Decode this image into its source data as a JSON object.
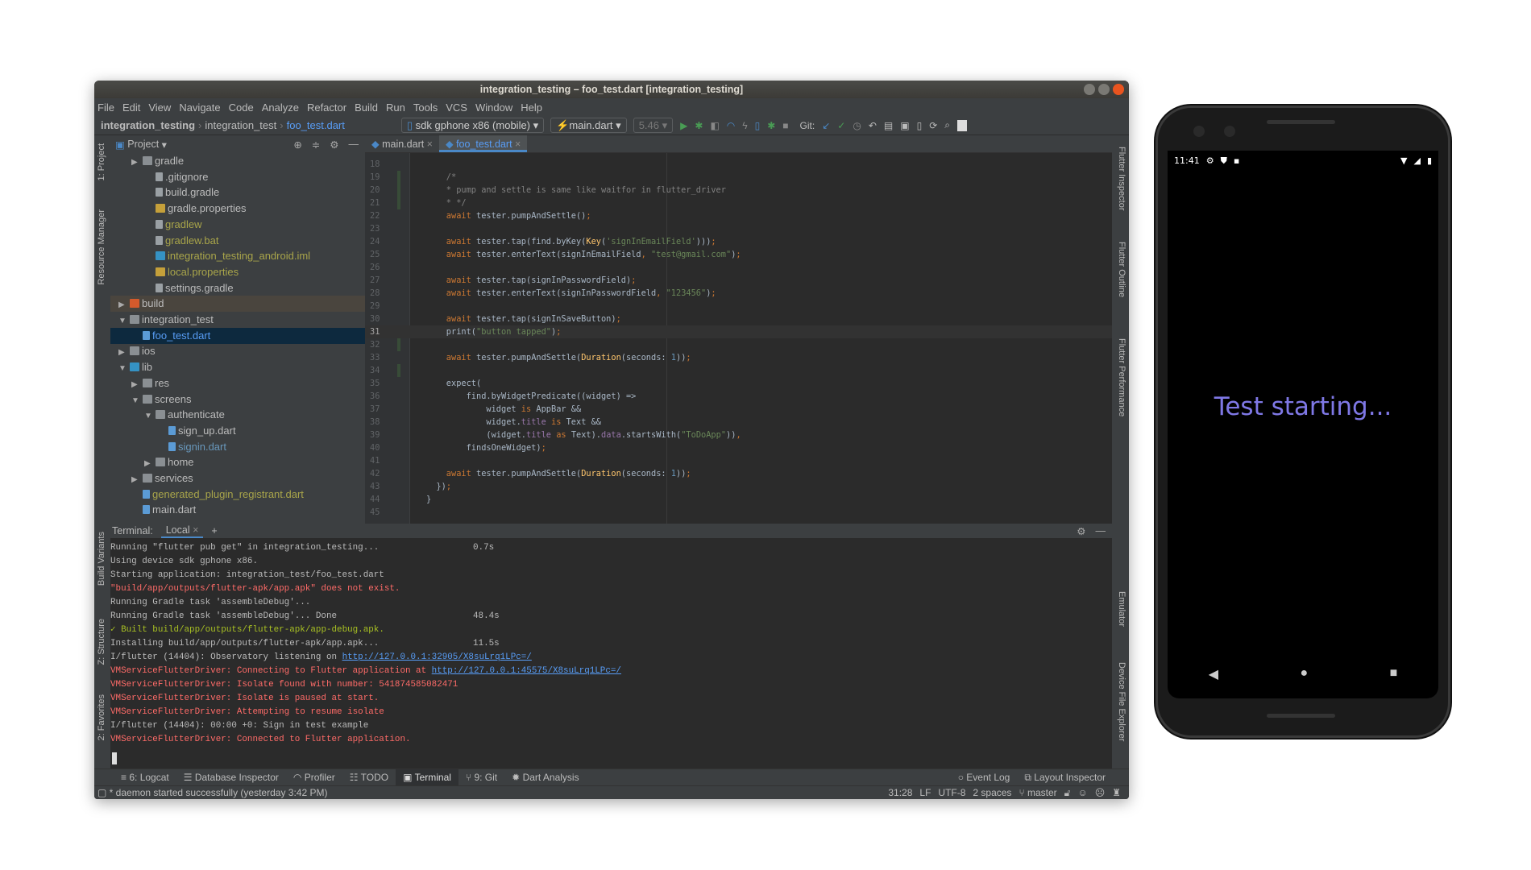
{
  "window": {
    "title": "integration_testing – foo_test.dart [integration_testing]"
  },
  "menu": [
    "File",
    "Edit",
    "View",
    "Navigate",
    "Code",
    "Analyze",
    "Refactor",
    "Build",
    "Run",
    "Tools",
    "VCS",
    "Window",
    "Help"
  ],
  "navbar": {
    "breadcrumb": [
      "integration_testing",
      "integration_test",
      "foo_test.dart"
    ],
    "device": "sdk gphone x86 (mobile)",
    "run_config": "main.dart",
    "hot_reload": "5.46",
    "git_label": "Git:"
  },
  "project": {
    "title": "Project",
    "tree": [
      {
        "label": "gradle",
        "depth": 2,
        "arrow": "right",
        "icon": "folder",
        "color": "def"
      },
      {
        "label": ".gitignore",
        "depth": 3,
        "icon": "file",
        "color": "def"
      },
      {
        "label": "build.gradle",
        "depth": 3,
        "icon": "gradle",
        "color": "def"
      },
      {
        "label": "gradle.properties",
        "depth": 3,
        "icon": "properties",
        "color": "def"
      },
      {
        "label": "gradlew",
        "depth": 3,
        "icon": "script",
        "color": "untr"
      },
      {
        "label": "gradlew.bat",
        "depth": 3,
        "icon": "script",
        "color": "untr"
      },
      {
        "label": "integration_testing_android.iml",
        "depth": 3,
        "icon": "module",
        "color": "untr"
      },
      {
        "label": "local.properties",
        "depth": 3,
        "icon": "properties",
        "color": "untr"
      },
      {
        "label": "settings.gradle",
        "depth": 3,
        "icon": "gradle",
        "color": "def"
      },
      {
        "label": "build",
        "depth": 1,
        "arrow": "right",
        "icon": "excluded-folder",
        "color": "def",
        "state": "excluded"
      },
      {
        "label": "integration_test",
        "depth": 1,
        "arrow": "down",
        "icon": "folder",
        "color": "def"
      },
      {
        "label": "foo_test.dart",
        "depth": 2,
        "icon": "dart",
        "color": "sel",
        "state": "selected"
      },
      {
        "label": "ios",
        "depth": 1,
        "arrow": "right",
        "icon": "folder",
        "color": "def"
      },
      {
        "label": "lib",
        "depth": 1,
        "arrow": "down",
        "icon": "source-folder",
        "color": "def"
      },
      {
        "label": "res",
        "depth": 2,
        "arrow": "right",
        "icon": "package",
        "color": "def"
      },
      {
        "label": "screens",
        "depth": 2,
        "arrow": "down",
        "icon": "package",
        "color": "def"
      },
      {
        "label": "authenticate",
        "depth": 3,
        "arrow": "down",
        "icon": "package",
        "color": "def"
      },
      {
        "label": "sign_up.dart",
        "depth": 4,
        "icon": "dart",
        "color": "def"
      },
      {
        "label": "signin.dart",
        "depth": 4,
        "icon": "dart",
        "color": "dart"
      },
      {
        "label": "home",
        "depth": 3,
        "arrow": "right",
        "icon": "package",
        "color": "def"
      },
      {
        "label": "services",
        "depth": 2,
        "arrow": "right",
        "icon": "package",
        "color": "def"
      },
      {
        "label": "generated_plugin_registrant.dart",
        "depth": 2,
        "icon": "dart",
        "color": "untr"
      },
      {
        "label": "main.dart",
        "depth": 2,
        "icon": "dart",
        "color": "def"
      }
    ]
  },
  "left_stripe": [
    "1: Project",
    "Resource Manager",
    "Build Variants",
    "Z: Structure",
    "2: Favorites"
  ],
  "right_stripe": [
    "Flutter Inspector",
    "Flutter Outline",
    "Flutter Performance",
    "Emulator",
    "Device File Explorer"
  ],
  "editor": {
    "tabs": [
      {
        "label": "main.dart",
        "active": false
      },
      {
        "label": "foo_test.dart",
        "active": true
      }
    ],
    "first_line": 18,
    "current_line": 31,
    "lines": [
      [],
      [
        [
          "    /*",
          "c"
        ]
      ],
      [
        [
          "    * pump and settle is same like waitfor in flutter_driver",
          "c"
        ]
      ],
      [
        [
          "    * */",
          "c"
        ]
      ],
      [
        [
          "    await ",
          "k"
        ],
        [
          "tester.pumpAndSettle()",
          ""
        ],
        [
          ";",
          "k"
        ]
      ],
      [],
      [
        [
          "    await ",
          "k"
        ],
        [
          "tester.tap(find.byKey(",
          ""
        ],
        [
          "Key",
          "f"
        ],
        [
          "(",
          ""
        ],
        [
          "'signInEmailField'",
          "s"
        ],
        [
          ")))",
          ""
        ],
        [
          ";",
          "k"
        ]
      ],
      [
        [
          "    await ",
          "k"
        ],
        [
          "tester.enterText(signInEmailField",
          ""
        ],
        [
          ", ",
          "k"
        ],
        [
          "\"test@gmail.com\"",
          "s"
        ],
        [
          ")",
          ""
        ],
        [
          ";",
          "k"
        ]
      ],
      [],
      [
        [
          "    await ",
          "k"
        ],
        [
          "tester.tap(signInPasswordField)",
          ""
        ],
        [
          ";",
          "k"
        ]
      ],
      [
        [
          "    await ",
          "k"
        ],
        [
          "tester.enterText(signInPasswordField",
          ""
        ],
        [
          ", ",
          "k"
        ],
        [
          "\"123456\"",
          "s"
        ],
        [
          ")",
          ""
        ],
        [
          ";",
          "k"
        ]
      ],
      [],
      [
        [
          "    await ",
          "k"
        ],
        [
          "tester.tap(signInSaveButton)",
          ""
        ],
        [
          ";",
          "k"
        ]
      ],
      [
        [
          "    print(",
          ""
        ],
        [
          "\"button tapped\"",
          "s"
        ],
        [
          ")",
          ""
        ],
        [
          ";",
          "k"
        ]
      ],
      [],
      [
        [
          "    await ",
          "k"
        ],
        [
          "tester.pumpAndSettle(",
          ""
        ],
        [
          "Duration",
          "f"
        ],
        [
          "(seconds: ",
          ""
        ],
        [
          "1",
          "n"
        ],
        [
          "))",
          ""
        ],
        [
          ";",
          "k"
        ]
      ],
      [],
      [
        [
          "    expect(",
          ""
        ]
      ],
      [
        [
          "        find.byWidgetPredicate((widget) =>",
          ""
        ]
      ],
      [
        [
          "            widget ",
          ""
        ],
        [
          "is ",
          "k"
        ],
        [
          "AppBar &&",
          ""
        ]
      ],
      [
        [
          "            widget.",
          ""
        ],
        [
          "title ",
          "p"
        ],
        [
          "is ",
          "k"
        ],
        [
          "Text &&",
          ""
        ]
      ],
      [
        [
          "            (widget.",
          ""
        ],
        [
          "title ",
          "p"
        ],
        [
          "as ",
          "k"
        ],
        [
          "Text).",
          ""
        ],
        [
          "data",
          "p"
        ],
        [
          ".startsWith(",
          ""
        ],
        [
          "\"ToDoApp\"",
          "s"
        ],
        [
          "))",
          ""
        ],
        [
          ",",
          "k"
        ]
      ],
      [
        [
          "        findsOneWidget)",
          ""
        ],
        [
          ";",
          "k"
        ]
      ],
      [],
      [
        [
          "    await ",
          "k"
        ],
        [
          "tester.pumpAndSettle(",
          ""
        ],
        [
          "Duration",
          "f"
        ],
        [
          "(seconds: ",
          ""
        ],
        [
          "1",
          "n"
        ],
        [
          "))",
          ""
        ],
        [
          ";",
          "k"
        ]
      ],
      [
        [
          "  })",
          ""
        ],
        [
          ";",
          "k"
        ]
      ],
      [
        [
          "}",
          ""
        ]
      ],
      []
    ]
  },
  "terminal": {
    "label": "Terminal:",
    "tab": "Local",
    "add": "+",
    "lines": [
      {
        "kind": "normal",
        "parts": [
          {
            "text": "Running \"flutter pub get\" in integration_testing..."
          }
        ],
        "time": "0.7s"
      },
      {
        "kind": "normal",
        "parts": [
          {
            "text": "Using device sdk gphone x86."
          }
        ]
      },
      {
        "kind": "normal",
        "parts": [
          {
            "text": "Starting application: integration_test/foo_test.dart"
          }
        ]
      },
      {
        "kind": "err",
        "parts": [
          {
            "text": "\"build/app/outputs/flutter-apk/app.apk\" does not exist."
          }
        ]
      },
      {
        "kind": "normal",
        "parts": [
          {
            "text": "Running Gradle task 'assembleDebug'..."
          }
        ]
      },
      {
        "kind": "normal",
        "parts": [
          {
            "text": "Running Gradle task 'assembleDebug'... Done"
          }
        ],
        "time": "48.4s"
      },
      {
        "kind": "ok",
        "parts": [
          {
            "text": "✓ Built build/app/outputs/flutter-apk/app-debug.apk."
          }
        ]
      },
      {
        "kind": "normal",
        "parts": [
          {
            "text": "Installing build/app/outputs/flutter-apk/app.apk..."
          }
        ],
        "time": "11.5s"
      },
      {
        "kind": "normal",
        "parts": [
          {
            "text": "I/flutter (14404): Observatory listening on "
          },
          {
            "text": "http://127.0.0.1:32905/X8suLrq1LPc=/",
            "link": true
          }
        ]
      },
      {
        "kind": "err",
        "parts": [
          {
            "text": "VMServiceFlutterDriver: Connecting to Flutter application at "
          },
          {
            "text": "http://127.0.0.1:45575/X8suLrq1LPc=/",
            "link": true
          }
        ]
      },
      {
        "kind": "err",
        "parts": [
          {
            "text": "VMServiceFlutterDriver: Isolate found with number: 541874585082471"
          }
        ]
      },
      {
        "kind": "err",
        "parts": [
          {
            "text": "VMServiceFlutterDriver: Isolate is paused at start."
          }
        ]
      },
      {
        "kind": "err",
        "parts": [
          {
            "text": "VMServiceFlutterDriver: Attempting to resume isolate"
          }
        ]
      },
      {
        "kind": "normal",
        "parts": [
          {
            "text": "I/flutter (14404): 00:00 +0: Sign in test example"
          }
        ]
      },
      {
        "kind": "err",
        "parts": [
          {
            "text": "VMServiceFlutterDriver: Connected to Flutter application."
          }
        ]
      }
    ]
  },
  "bottom_tabs": [
    {
      "label": "6: Logcat",
      "icon": "≡"
    },
    {
      "label": "Database Inspector",
      "icon": "☰"
    },
    {
      "label": "Profiler",
      "icon": "◠"
    },
    {
      "label": "TODO",
      "icon": "☷"
    },
    {
      "label": "Terminal",
      "icon": "▣",
      "active": true
    },
    {
      "label": "9: Git",
      "icon": "⑂"
    },
    {
      "label": "Dart Analysis",
      "icon": "✹"
    }
  ],
  "bottom_right_tabs": [
    {
      "label": "Event Log",
      "icon": "○"
    },
    {
      "label": "Layout Inspector",
      "icon": "⧉"
    }
  ],
  "status": {
    "message": "* daemon started successfully (yesterday 3:42 PM)",
    "position": "31:28",
    "line_sep": "LF",
    "encoding": "UTF-8",
    "indent": "2 spaces",
    "branch": "master"
  },
  "phone": {
    "time": "11:41",
    "app_text": "Test starting...",
    "app_text_color": "#7f78e6"
  },
  "colors": {
    "keyword": "#cc7832",
    "string": "#6a8759",
    "comment": "#808080",
    "error": "#ff6b68",
    "link": "#589df6",
    "accent": "#4a88c7"
  }
}
